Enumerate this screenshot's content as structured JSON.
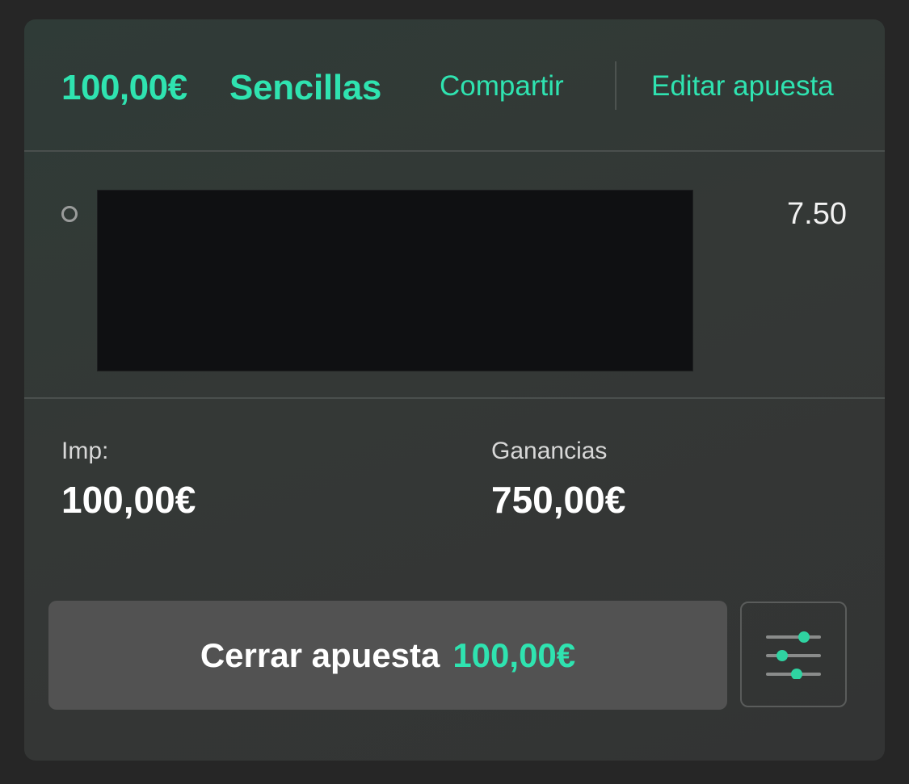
{
  "header": {
    "amount": "100,00€",
    "bet_type": "Sencillas",
    "share_label": "Compartir",
    "edit_label": "Editar apuesta"
  },
  "selection": {
    "odds": "7.50"
  },
  "summary": {
    "stake_label": "Imp:",
    "stake_value": "100,00€",
    "winnings_label": "Ganancias",
    "winnings_value": "750,00€"
  },
  "cashout": {
    "label": "Cerrar apuesta",
    "amount": "100,00€"
  },
  "icons": {
    "settings": "sliders-icon",
    "selection_status": "radio-circle-icon"
  },
  "colors": {
    "accent": "#2fe3b0",
    "background": "#262626",
    "card": "#333634",
    "button": "#525252"
  }
}
